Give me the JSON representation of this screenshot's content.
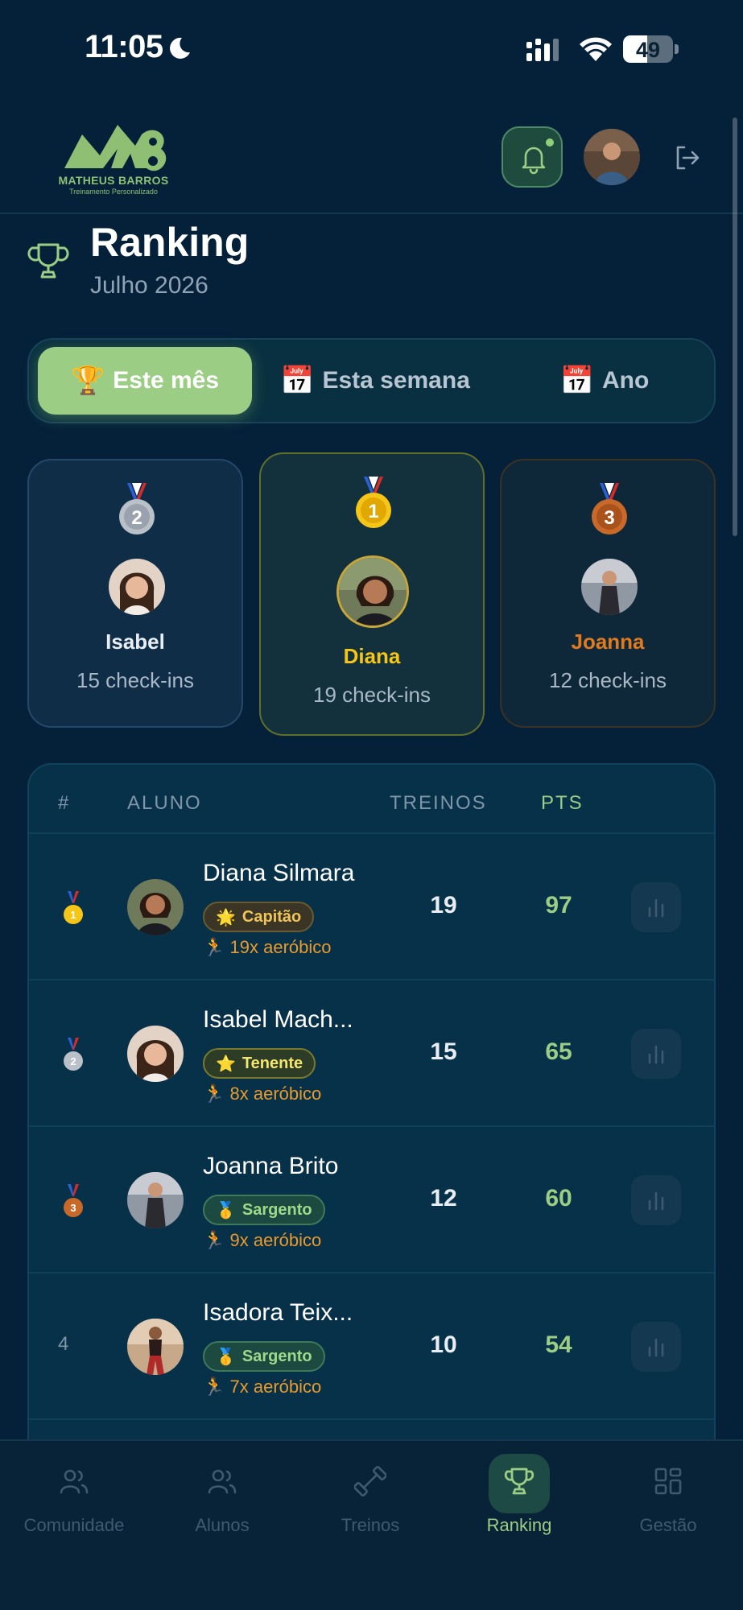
{
  "status_bar": {
    "time": "11:05",
    "battery": "49",
    "battery_level": 0.49
  },
  "logo": {
    "title": "MATHEUS BARROS",
    "subtitle": "Treinamento Personalizado"
  },
  "header": {
    "title": "Ranking",
    "subtitle": "Julho 2026"
  },
  "tabs": [
    {
      "emoji": "🏆",
      "label": "Este mês",
      "active": true
    },
    {
      "emoji": "📅",
      "label": "Esta semana",
      "active": false
    },
    {
      "emoji": "📅",
      "label": "Ano",
      "active": false
    }
  ],
  "podium": {
    "first": {
      "name": "Diana",
      "checkins": "19 check-ins",
      "medal": "1"
    },
    "second": {
      "name": "Isabel",
      "checkins": "15 check-ins",
      "medal": "2"
    },
    "third": {
      "name": "Joanna",
      "checkins": "12 check-ins",
      "medal": "3"
    }
  },
  "table": {
    "headers": {
      "rank": "#",
      "student": "ALUNO",
      "workouts": "TREINOS",
      "points": "PTS"
    },
    "rows": [
      {
        "rank": "1",
        "name": "Diana Silmara",
        "badge_emoji": "🌟",
        "badge": "Capitão",
        "aerobic_emoji": "🏃",
        "aerobic": "19x aeróbico",
        "workouts": "19",
        "points": "97"
      },
      {
        "rank": "2",
        "name": "Isabel Mach...",
        "badge_emoji": "⭐",
        "badge": "Tenente",
        "aerobic_emoji": "🏃",
        "aerobic": "8x aeróbico",
        "workouts": "15",
        "points": "65"
      },
      {
        "rank": "3",
        "name": "Joanna Brito",
        "badge_emoji": "🥇",
        "badge": "Sargento",
        "aerobic_emoji": "🏃",
        "aerobic": "9x aeróbico",
        "workouts": "12",
        "points": "60"
      },
      {
        "rank": "4",
        "name": "Isadora Teix...",
        "badge_emoji": "🥇",
        "badge": "Sargento",
        "aerobic_emoji": "🏃",
        "aerobic": "7x aeróbico",
        "workouts": "10",
        "points": "54"
      }
    ]
  },
  "bottom_nav": [
    {
      "label": "Comunidade",
      "icon": "users-icon",
      "active": false
    },
    {
      "label": "Alunos",
      "icon": "users-icon",
      "active": false
    },
    {
      "label": "Treinos",
      "icon": "dumbbell-icon",
      "active": false
    },
    {
      "label": "Ranking",
      "icon": "trophy-icon",
      "active": true
    },
    {
      "label": "Gestão",
      "icon": "grid-icon",
      "active": false
    }
  ],
  "colors": {
    "background": "#05213a",
    "accent": "#9ccd84",
    "gold": "#f5c518",
    "bronze": "#e07a1f",
    "aerobic": "#e89a2e"
  }
}
